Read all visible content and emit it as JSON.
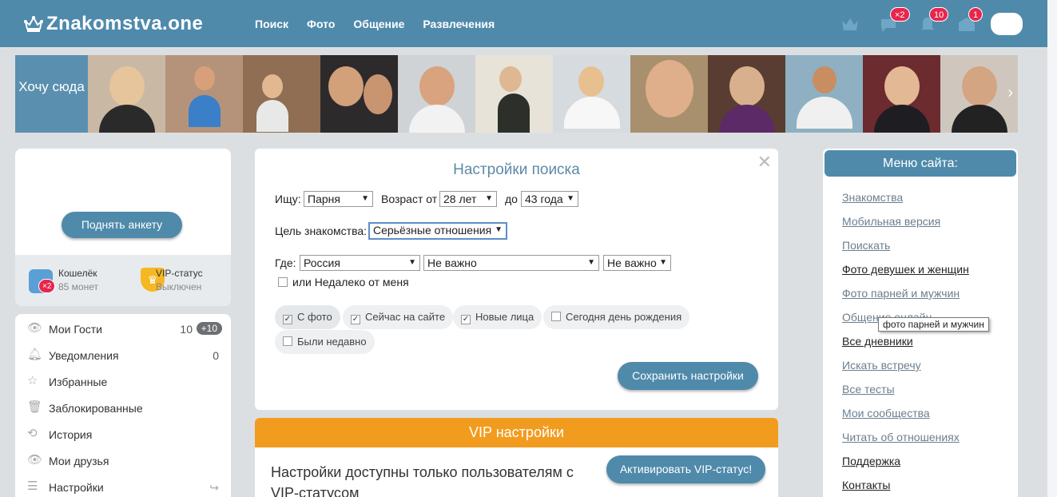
{
  "header": {
    "logo": "Znakomstva.one",
    "nav": [
      "Поиск",
      "Фото",
      "Общение",
      "Развлечения"
    ],
    "badges": {
      "messages": "×2",
      "notifications": "10",
      "mail": "1"
    }
  },
  "strip": {
    "want_here": "Хочу сюда"
  },
  "left": {
    "raise_button": "Поднять анкету",
    "wallet": {
      "title": "Кошелёк",
      "sub": "85 монет",
      "badge": "×2"
    },
    "vip": {
      "title": "VIP-статус",
      "sub": "Выключен"
    },
    "menu": [
      {
        "label": "Мои Гости",
        "count": "10",
        "plus": "+10",
        "icon": "eye-icon"
      },
      {
        "label": "Уведомления",
        "count": "0",
        "icon": "bell-icon"
      },
      {
        "label": "Избранные",
        "icon": "star-icon"
      },
      {
        "label": "Заблокированные",
        "icon": "trash-icon"
      },
      {
        "label": "История",
        "icon": "history-icon"
      },
      {
        "label": "Мои друзья",
        "icon": "eye-icon"
      },
      {
        "label": "Настройки",
        "icon": "sliders-icon"
      }
    ]
  },
  "search": {
    "title": "Настройки поиска",
    "seek_label": "Ищу:",
    "seek_value": "Парня",
    "age_from_label": "Возраст от",
    "age_from_value": "28 лет",
    "age_to_label": "до",
    "age_to_value": "43 года",
    "goal_label": "Цель знакомства:",
    "goal_value": "Серьёзные отношения",
    "where_label": "Где:",
    "country_value": "Россия",
    "region_value": "Не важно",
    "city_value": "Не важно",
    "nearby_label": "или Недалеко от меня",
    "filters": [
      {
        "label": "С фото",
        "checked": true
      },
      {
        "label": "Сейчас на сайте",
        "checked": true
      },
      {
        "label": "Новые лица",
        "checked": true
      },
      {
        "label": "Сегодня день рождения",
        "checked": false
      },
      {
        "label": "Были недавно",
        "checked": false
      }
    ],
    "save_button": "Сохранить настройки"
  },
  "vip_settings": {
    "title": "VIP настройки",
    "text": "Настройки доступны только пользователям с VIP-статусом",
    "button": "Активировать VIP-статус!"
  },
  "right_menu": {
    "title": "Меню сайта:",
    "links": [
      {
        "label": "Знакомства",
        "style": "grey"
      },
      {
        "label": "Мобильная версия",
        "style": "grey"
      },
      {
        "label": "Поискать",
        "style": "grey"
      },
      {
        "label": "Фото девушек и женщин",
        "style": "dark"
      },
      {
        "label": "Фото парней и мужчин",
        "style": "grey"
      },
      {
        "label": "Общение онлайн",
        "style": "grey"
      },
      {
        "label": "Все дневники",
        "style": "dark"
      },
      {
        "label": "Искать встречу",
        "style": "grey"
      },
      {
        "label": "Все тесты",
        "style": "grey"
      },
      {
        "label": "Мои сообщества",
        "style": "grey"
      },
      {
        "label": "Читать об отношениях",
        "style": "grey"
      },
      {
        "label": "Поддержка",
        "style": "dark"
      },
      {
        "label": "Контакты",
        "style": "dark"
      }
    ],
    "tooltip": "фото парней и мужчин"
  }
}
